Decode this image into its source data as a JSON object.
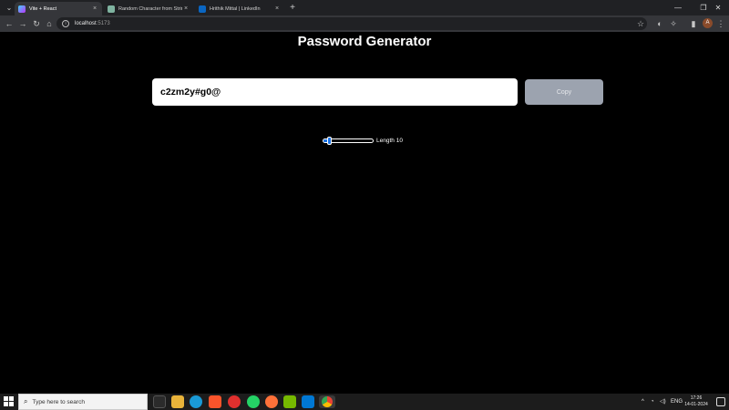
{
  "browser": {
    "tabs": [
      {
        "title": "Vite + React",
        "close": "×",
        "favicon_color": "#a855f7"
      },
      {
        "title": "Random Character from String",
        "close": "×",
        "favicon_color": "#7fb3a0"
      },
      {
        "title": "Hrithik Mittal | LinkedIn",
        "close": "×",
        "favicon_color": "#0a66c2"
      }
    ],
    "new_tab": "+",
    "address": {
      "host": "localhost",
      "port": ":5173"
    },
    "profile_initial": "A"
  },
  "page": {
    "title": "Password Generator",
    "password": "c2zm2y#g0@",
    "copy_label": "Copy",
    "length_label": "Length",
    "length_value": "10",
    "slider_fraction": 0.1
  },
  "taskbar": {
    "search_placeholder": "Type here to search",
    "language": "ENG",
    "time": "17:26",
    "date": "14-01-2024"
  },
  "colors": {
    "accent": "#1a73e8",
    "copy_button": "#9ca3af"
  }
}
